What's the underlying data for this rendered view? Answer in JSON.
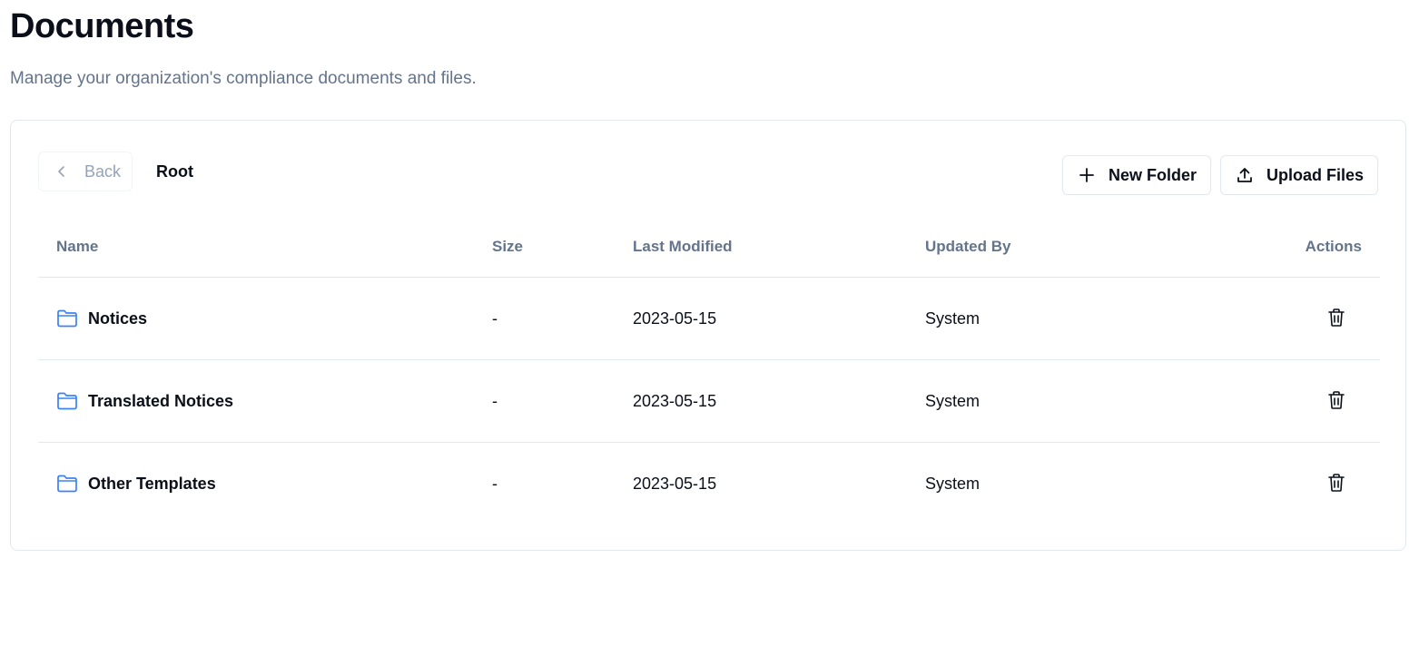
{
  "page": {
    "title": "Documents",
    "subtitle": "Manage your organization's compliance documents and files."
  },
  "toolbar": {
    "back_label": "Back",
    "back_icon": "chevron-left-icon",
    "current_folder": "Root",
    "new_folder_label": "New Folder",
    "new_folder_icon": "plus-icon",
    "upload_label": "Upload Files",
    "upload_icon": "upload-icon"
  },
  "table": {
    "columns": [
      "Name",
      "Size",
      "Last Modified",
      "Updated By",
      "Actions"
    ],
    "rows": [
      {
        "name": "Notices",
        "size": "-",
        "modified": "2023-05-15",
        "updated_by": "System",
        "icon": "folder-icon",
        "action_icon": "trash-icon"
      },
      {
        "name": "Translated Notices",
        "size": "-",
        "modified": "2023-05-15",
        "updated_by": "System",
        "icon": "folder-icon",
        "action_icon": "trash-icon"
      },
      {
        "name": "Other Templates",
        "size": "-",
        "modified": "2023-05-15",
        "updated_by": "System",
        "icon": "folder-icon",
        "action_icon": "trash-icon"
      }
    ]
  },
  "colors": {
    "folder_icon": "#3b82f6",
    "muted_text": "#64748b",
    "border": "#e2e8f0"
  }
}
